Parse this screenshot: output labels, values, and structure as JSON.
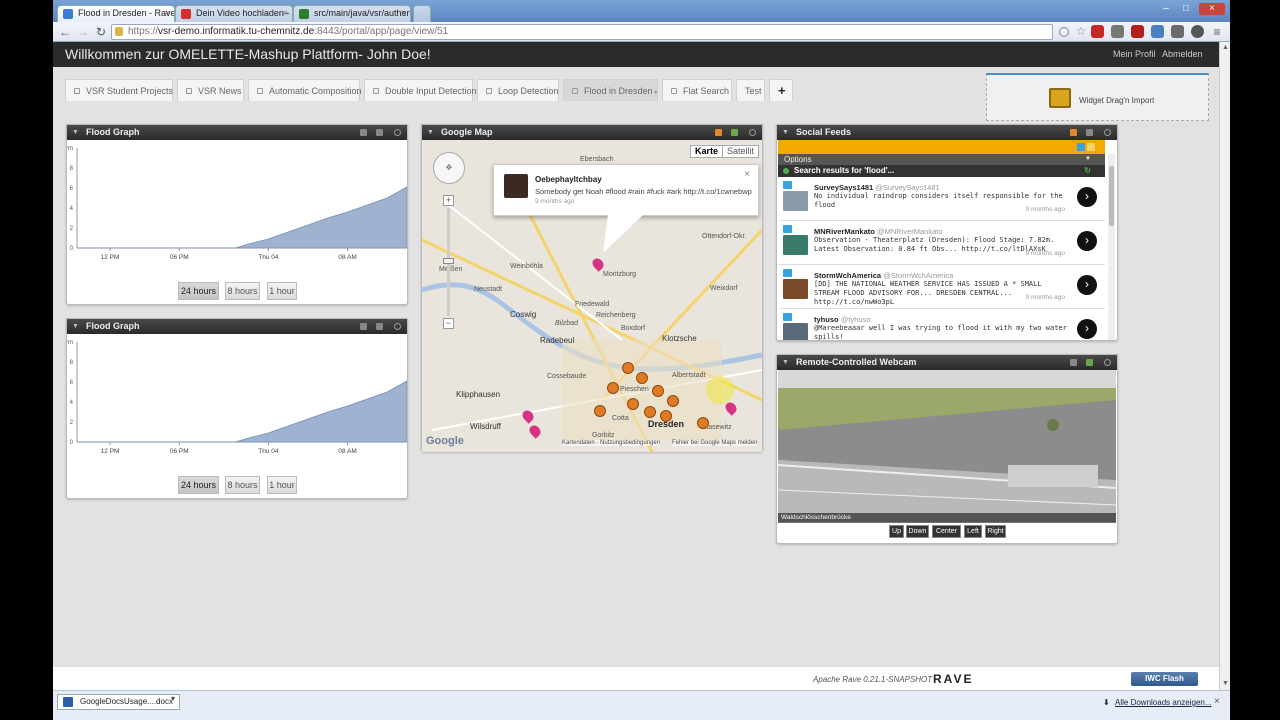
{
  "browser": {
    "tabs": [
      {
        "title": "Flood in Dresden - Rave",
        "fav": "#3a7bd5"
      },
      {
        "title": "Dein Video hochladen - Y",
        "fav": "#d32f2f"
      },
      {
        "title": "src/main/java/vsr/authen",
        "fav": "#2e7d32"
      }
    ],
    "url_prefix": "https://",
    "url_host": "vsr-demo.informatik.tu-chemnitz.de",
    "url_path": ":8443/portal/app/page/view/51"
  },
  "header": {
    "title": "Willkommen zur OMELETTE-Mashup Plattform- John Doe!",
    "profile_link": "Mein Profil",
    "logout_link": "Abmelden"
  },
  "page_tabs": [
    "VSR Student Projects",
    "VSR News",
    "Automatic Composition",
    "Double Input Detection",
    "Loop Detection",
    "Flood in Dresden",
    "Flat Search",
    "Test"
  ],
  "active_tab": "Flood in Dresden",
  "add_tab_label": "+",
  "import_label": "Widget Drag'n Import",
  "flood_graph": {
    "title": "Flood Graph",
    "buttons": [
      "24 hours",
      "8 hours",
      "1 hour"
    ]
  },
  "chart_data": [
    {
      "type": "area",
      "y_unit_label": "10^m",
      "yticks": [
        0,
        2,
        4,
        6,
        8,
        10
      ],
      "ylim": [
        0,
        10
      ],
      "xtick_labels": [
        "12 PM",
        "06 PM",
        "Thu 04",
        "08 AM"
      ],
      "x_positions": [
        0.1,
        0.31,
        0.58,
        0.82
      ],
      "x": [
        0,
        0.48,
        0.52,
        0.58,
        0.64,
        0.7,
        0.76,
        0.82,
        0.88,
        0.94,
        1.0
      ],
      "y": [
        0,
        0,
        0.4,
        0.9,
        1.6,
        2.3,
        3.0,
        3.6,
        4.3,
        5.0,
        6.1
      ],
      "color": "#9fb3d1"
    },
    {
      "type": "area",
      "y_unit_label": "10^m",
      "yticks": [
        0,
        2,
        4,
        6,
        8,
        10
      ],
      "ylim": [
        0,
        10
      ],
      "xtick_labels": [
        "12 PM",
        "06 PM",
        "Thu 04",
        "08 AM"
      ],
      "x_positions": [
        0.1,
        0.31,
        0.58,
        0.82
      ],
      "x": [
        0,
        0.48,
        0.52,
        0.58,
        0.64,
        0.7,
        0.76,
        0.82,
        0.88,
        0.94,
        1.0
      ],
      "y": [
        0,
        0,
        0.4,
        0.9,
        1.6,
        2.3,
        3.0,
        3.6,
        4.3,
        5.0,
        6.1
      ],
      "color": "#9fb3d1"
    }
  ],
  "google_map": {
    "title": "Google Map",
    "type_map": "Karte",
    "type_sat": "Satellit",
    "popup": {
      "name": "Oebephayltchbay",
      "text": "Somebody get Noah #flood #rain #fuck #ark http://t.co/1cwnebwp",
      "time": "9 months ago",
      "close": "×"
    },
    "places": [
      "Ebersbach",
      "Weinböhla",
      "Moritzburg",
      "Meißen",
      "Neustadt",
      "Coswig",
      "Friedewald",
      "Reichenberg",
      "Radebeul",
      "Boxdorf",
      "Klotzsche",
      "Weixdorf",
      "Ottendorf-Okr.",
      "Klipphausen",
      "Cossebaude",
      "Wilsdruff",
      "Dresden",
      "Albertstadt",
      "Pieschen",
      "Cotta",
      "Gorbitz",
      "Blasewitz",
      "Bilzbad"
    ],
    "google_logo": "Google",
    "attribution": "Kartendaten - Nutzungsbedingungen",
    "report": "Fehler bei Google Maps melden"
  },
  "social": {
    "title": "Social Feeds",
    "options": "Options",
    "search": "Search results for 'flood'...",
    "feeds": [
      {
        "user": "SurveySays1481",
        "handle": "@SurveySays1481",
        "text": "No individual raindrop considers itself responsible for the flood",
        "time": "9 months ago",
        "thumb": "#8a9aa8"
      },
      {
        "user": "MNRiverMankato",
        "handle": "@MNRiverMankato",
        "text": "Observation - Theaterplatz (Dresden): Flood Stage: 7.82m. Latest Observation: 0.84 ft Obs... http://t.co/ltDlAXsK",
        "time": "9 months ago",
        "thumb": "#3a7a6a"
      },
      {
        "user": "StormWchAmerica",
        "handle": "@StormWchAmerica",
        "text": "[DD] THE NATIONAL WEATHER SERVICE HAS ISSUED A * SMALL STREAM FLOOD ADVISORY FOR... DRESDEN CENTRAL... http://t.co/nwWo3pL",
        "time": "9 months ago",
        "thumb": "#7a4a2a"
      },
      {
        "user": "tyhuso",
        "handle": "@tyhuso",
        "text": "@Mareebeaaar well I was trying to flood it with my two water spills!",
        "time": "",
        "thumb": "#5a6a7a"
      }
    ],
    "go": "›"
  },
  "webcam": {
    "title": "Remote-Controlled Webcam",
    "caption": "Waldschlösschenbrücke",
    "buttons": [
      "Up",
      "Down",
      "Center",
      "Left",
      "Right"
    ]
  },
  "footer": {
    "version": "Apache Rave 0.21.1-SNAPSHOT",
    "logo": "RAVE",
    "iwc": "IWC Flash"
  },
  "downloads": {
    "file": "GoogleDocsUsage....docx",
    "show_all": "Alle Downloads anzeigen..."
  },
  "colors": {
    "accent": "#f2a900",
    "twitter": "#35a3e0",
    "header": "#2b2b2b"
  }
}
